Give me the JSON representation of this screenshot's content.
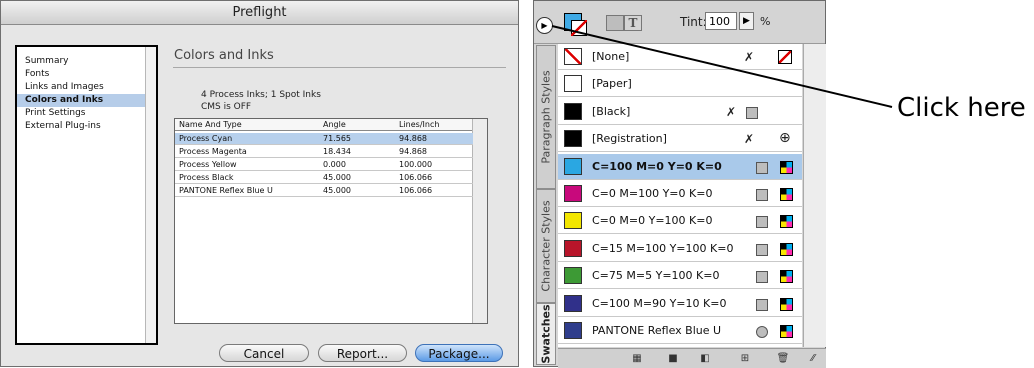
{
  "preflight": {
    "title": "Preflight",
    "sidebar": [
      "Summary",
      "Fonts",
      "Links and Images",
      "Colors and Inks",
      "Print Settings",
      "External Plug-ins"
    ],
    "selected_index": 3,
    "section_title": "Colors and Inks",
    "summary_line1": "4 Process Inks; 1 Spot Inks",
    "summary_line2": "CMS is OFF",
    "table": {
      "headers": [
        "Name And Type",
        "Angle",
        "Lines/Inch"
      ],
      "rows": [
        [
          "Process Cyan",
          "71.565",
          "94.868"
        ],
        [
          "Process Magenta",
          "18.434",
          "94.868"
        ],
        [
          "Process Yellow",
          "0.000",
          "100.000"
        ],
        [
          "Process Black",
          "45.000",
          "106.066"
        ],
        [
          "PANTONE Reflex Blue U",
          "45.000",
          "106.066"
        ]
      ],
      "selected_row": 0
    },
    "buttons": {
      "cancel": "Cancel",
      "report": "Report...",
      "package": "Package..."
    }
  },
  "swatches_panel": {
    "tint_label": "Tint:",
    "tint_value": "100",
    "tint_unit": "%",
    "tabs": {
      "paragraph": "Paragraph Styles",
      "character": "Character Styles",
      "swatches": "Swatches"
    },
    "swatches": [
      {
        "name": "[None]",
        "color": "#ffffff",
        "icon": "none"
      },
      {
        "name": "[Paper]",
        "color": "#ffffff",
        "icon": ""
      },
      {
        "name": "[Black]",
        "color": "#000000",
        "icon": "noedit-spot"
      },
      {
        "name": "[Registration]",
        "color": "#000000",
        "icon": "noedit-registration"
      },
      {
        "name": "C=100 M=0 Y=0 K=0",
        "color": "#2aa7e2",
        "icon": "process"
      },
      {
        "name": "C=0 M=100 Y=0 K=0",
        "color": "#c8097c",
        "icon": "process"
      },
      {
        "name": "C=0 M=0 Y=100 K=0",
        "color": "#f3e600",
        "icon": "process"
      },
      {
        "name": "C=15 M=100 Y=100 K=0",
        "color": "#b8152a",
        "icon": "process"
      },
      {
        "name": "C=75 M=5 Y=100 K=0",
        "color": "#3d9a35",
        "icon": "process"
      },
      {
        "name": "C=100 M=90 Y=10 K=0",
        "color": "#30308a",
        "icon": "process"
      },
      {
        "name": "PANTONE Reflex Blue U",
        "color": "#2f3d8c",
        "icon": "spot"
      }
    ],
    "selected_index": 4
  },
  "annotation": {
    "text": "Click here"
  }
}
